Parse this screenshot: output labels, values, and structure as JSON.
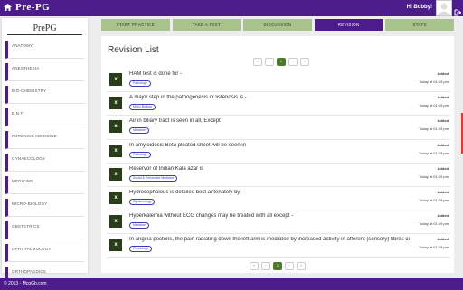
{
  "header": {
    "brand": "Pre-PG",
    "greeting": "Hi Bobby!",
    "icons": [
      "home-icon",
      "user-avatar-icon",
      "logout-icon"
    ]
  },
  "sidebar": {
    "title": "PrePG",
    "items": [
      {
        "label": "Anatomy"
      },
      {
        "label": "Anesthesia"
      },
      {
        "label": "Bio-Chemistry"
      },
      {
        "label": "E.N.T"
      },
      {
        "label": "Forensic Medicine"
      },
      {
        "label": "Gynaecology"
      },
      {
        "label": "Medicine"
      },
      {
        "label": "Micro-Biology"
      },
      {
        "label": "Obstetrics"
      },
      {
        "label": "Ophthalmology"
      },
      {
        "label": "Orthopaedics"
      }
    ]
  },
  "tabs": [
    {
      "label": "Start Practice",
      "active": false
    },
    {
      "label": "Take a Test",
      "active": false
    },
    {
      "label": "Discussion",
      "active": false
    },
    {
      "label": "Revision",
      "active": true
    },
    {
      "label": "Stats",
      "active": false
    }
  ],
  "panel": {
    "title": "Revision List",
    "pager": {
      "first": "«",
      "prev": "‹",
      "current": "1",
      "next": "›",
      "last": "»"
    }
  },
  "questions": [
    {
      "x": "x",
      "text": "HAM test is done for -",
      "tag": "Pathology",
      "added_label": "Added",
      "date": "Today at 01:19 pm"
    },
    {
      "x": "x",
      "text": "A major step in the pathogenesis of listeriosis is -",
      "tag": "Micro-Biology",
      "added_label": "Added",
      "date": "Today at 01:19 pm"
    },
    {
      "x": "x",
      "text": "Air in biliary tract is seen in all, Except",
      "tag": "Medicine",
      "added_label": "Added",
      "date": "Today at 01:19 pm"
    },
    {
      "x": "x",
      "text": "In amyloidosis Beta pleated sheet will be seen in",
      "tag": "Pathology",
      "added_label": "Added",
      "date": "Today at 01:19 pm"
    },
    {
      "x": "x",
      "text": "Reservor of Indian Kala azar is",
      "tag": "Social & Preventive Medicine",
      "added_label": "Added",
      "date": "Today at 01:19 pm"
    },
    {
      "x": "x",
      "text": "Hydrocephalous is detailed best antenately by –",
      "tag": "Gynaecology",
      "added_label": "Added",
      "date": "Today at 01:19 pm"
    },
    {
      "x": "x",
      "text": "Hyperkalemia without ECG changes may be treated with all except -",
      "tag": "Medicine",
      "added_label": "Added",
      "date": "Today at 01:19 pm"
    },
    {
      "x": "x",
      "text": "In angina pectoris, the pain radiating down the left arm is mediated by increased activity in afferent (sensory) fibres co...",
      "tag": "Physiology",
      "added_label": "Added",
      "date": "Today at 01:19 pm"
    }
  ],
  "footer": {
    "text": "© 2013 - McqGb.com"
  },
  "colors": {
    "brand": "#4b1c8a",
    "tab": "#a8c48a",
    "delete": "#2a3d1a",
    "tag": "#3b3bbd"
  }
}
